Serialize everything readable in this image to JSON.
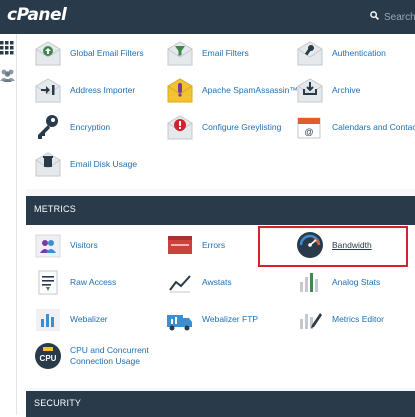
{
  "header": {
    "logo_text": "cPanel",
    "search_placeholder": "Search ("
  },
  "colors": {
    "header_bg": "#293a4a",
    "link": "#1f6fb2",
    "highlight": "#d6202a"
  },
  "email_items": [
    {
      "label": "Global Email Filters",
      "icon": "global-email-filters-icon"
    },
    {
      "label": "Email Filters",
      "icon": "email-filters-icon"
    },
    {
      "label": "Authentication",
      "icon": "authentication-icon"
    },
    {
      "label": "Address Importer",
      "icon": "address-importer-icon"
    },
    {
      "label": "Apache SpamAssassin™",
      "icon": "spamassassin-icon"
    },
    {
      "label": "Archive",
      "icon": "archive-icon"
    },
    {
      "label": "Encryption",
      "icon": "key-icon"
    },
    {
      "label": "Configure Greylisting",
      "icon": "greylisting-icon"
    },
    {
      "label": "Calendars and Contacts",
      "icon": "calendars-contacts-icon"
    },
    {
      "label": "Email Disk Usage",
      "icon": "email-disk-usage-icon"
    }
  ],
  "metrics": {
    "title": "METRICS",
    "items": [
      {
        "label": "Visitors",
        "icon": "visitors-icon"
      },
      {
        "label": "Errors",
        "icon": "errors-icon"
      },
      {
        "label": "Bandwidth",
        "icon": "bandwidth-gauge-icon"
      },
      {
        "label": "Raw Access",
        "icon": "raw-access-icon"
      },
      {
        "label": "Awstats",
        "icon": "awstats-icon"
      },
      {
        "label": "Analog Stats",
        "icon": "analog-stats-icon"
      },
      {
        "label": "Webalizer",
        "icon": "webalizer-icon"
      },
      {
        "label": "Webalizer FTP",
        "icon": "webalizer-ftp-icon"
      },
      {
        "label": "Metrics Editor",
        "icon": "metrics-editor-icon"
      },
      {
        "label": "CPU and Concurrent Connection Usage",
        "icon": "cpu-icon"
      }
    ]
  },
  "security": {
    "title": "SECURITY"
  }
}
